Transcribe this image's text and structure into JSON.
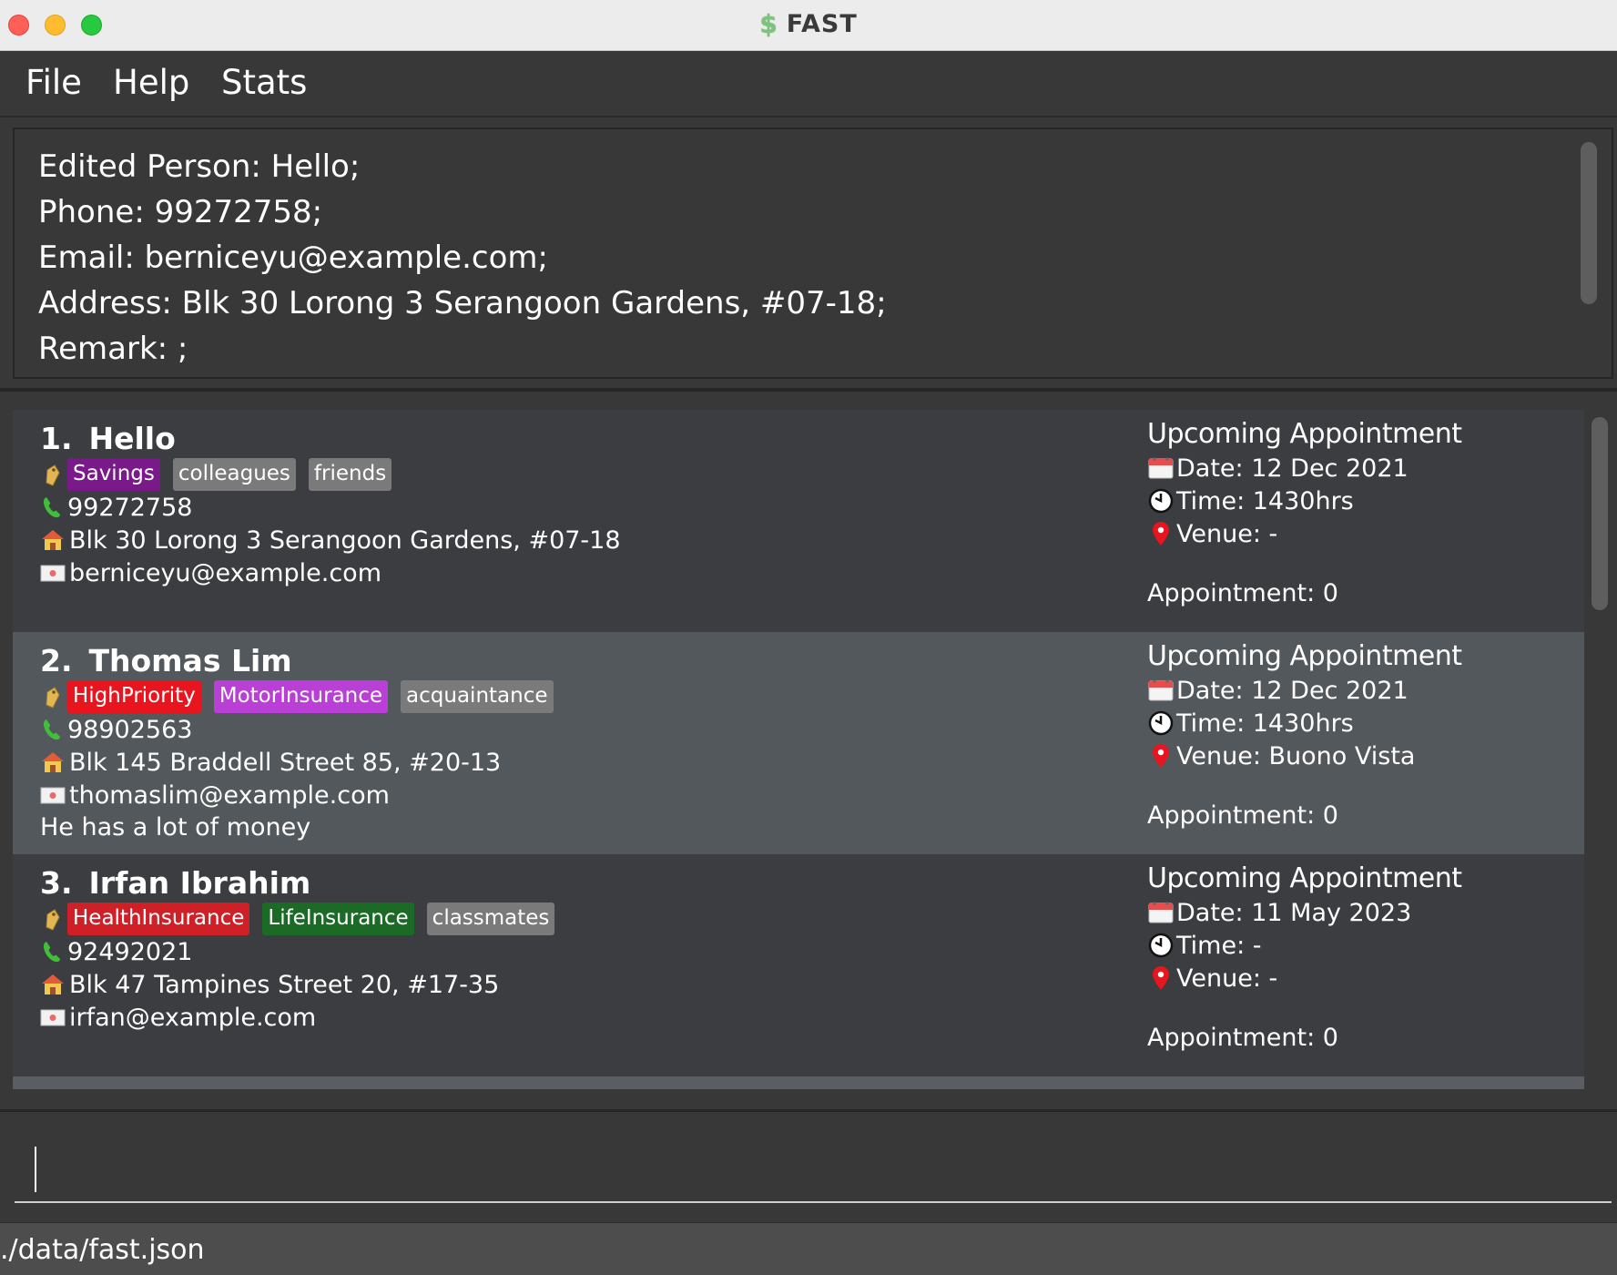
{
  "window": {
    "title": "FAST",
    "app_icon": "dollar-icon"
  },
  "menu": {
    "file": "File",
    "help": "Help",
    "stats": "Stats"
  },
  "result": {
    "lines": [
      "Edited Person: Hello;",
      "Phone: 99272758;",
      "Email: berniceyu@example.com;",
      "Address: Blk 30 Lorong 3 Serangoon Gardens, #07-18;",
      "Remark: ;"
    ]
  },
  "persons": [
    {
      "index": "1.",
      "name": "Hello",
      "tags": [
        {
          "label": "Savings",
          "color": "#7a1a8a"
        },
        {
          "label": "colleagues",
          "color": "#7a7a7a"
        },
        {
          "label": "friends",
          "color": "#7a7a7a"
        }
      ],
      "phone": "99272758",
      "address": "Blk 30 Lorong 3 Serangoon Gardens, #07-18",
      "email": "berniceyu@example.com",
      "remark": "",
      "appointment": {
        "heading": "Upcoming Appointment",
        "date": "Date: 12 Dec 2021",
        "time": "Time: 1430hrs",
        "venue": "Venue: -",
        "count": "Appointment: 0"
      }
    },
    {
      "index": "2.",
      "name": "Thomas Lim",
      "tags": [
        {
          "label": "HighPriority",
          "color": "#e8141e"
        },
        {
          "label": "MotorInsurance",
          "color": "#b93fd6"
        },
        {
          "label": "acquaintance",
          "color": "#7a7a7a"
        }
      ],
      "phone": "98902563",
      "address": "Blk 145 Braddell Street 85, #20-13",
      "email": "thomaslim@example.com",
      "remark": "He has a lot of money",
      "appointment": {
        "heading": "Upcoming Appointment",
        "date": "Date: 12 Dec 2021",
        "time": "Time: 1430hrs",
        "venue": "Venue: Buono Vista",
        "count": "Appointment: 0"
      }
    },
    {
      "index": "3.",
      "name": "Irfan Ibrahim",
      "tags": [
        {
          "label": "HealthInsurance",
          "color": "#cf2028"
        },
        {
          "label": "LifeInsurance",
          "color": "#1b6b26"
        },
        {
          "label": "classmates",
          "color": "#7a7a7a"
        }
      ],
      "phone": "92492021",
      "address": "Blk 47 Tampines Street 20, #17-35",
      "email": "irfan@example.com",
      "remark": "",
      "appointment": {
        "heading": "Upcoming Appointment",
        "date": "Date: 11 May 2023",
        "time": "Time: -",
        "venue": "Venue: -",
        "count": "Appointment: 0"
      }
    }
  ],
  "command": {
    "value": "",
    "placeholder": ""
  },
  "status": {
    "file_path": "./data/fast.json"
  },
  "icons": {
    "tag": "tag-icon",
    "phone": "phone-icon",
    "address": "house-icon",
    "email": "envelope-icon",
    "date": "calendar-icon",
    "time": "clock-icon",
    "venue": "location-pin-icon"
  }
}
